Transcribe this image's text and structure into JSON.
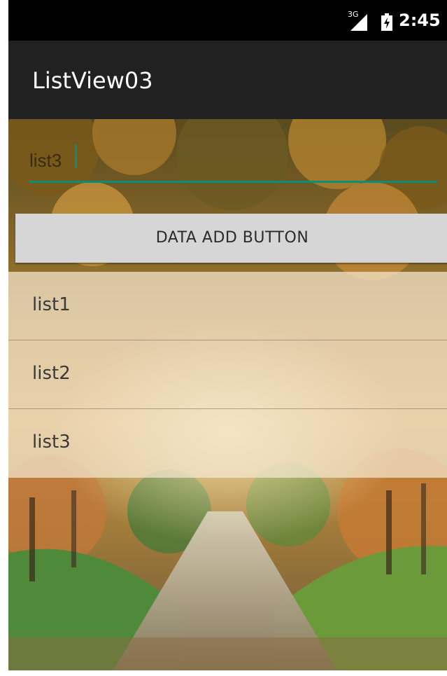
{
  "status_bar": {
    "network": "3G",
    "time": "2:45"
  },
  "action_bar": {
    "title": "ListView03"
  },
  "input": {
    "value": "list3"
  },
  "add_button": {
    "label": "DATA ADD BUTTON"
  },
  "list": {
    "items": [
      {
        "label": "list1"
      },
      {
        "label": "list2"
      },
      {
        "label": "list3"
      }
    ]
  },
  "colors": {
    "status_bar": "#000000",
    "action_bar": "#212121",
    "accent": "#0e8c7a",
    "button": "#d6d6d6"
  },
  "icons": [
    "signal-icon",
    "battery-icon"
  ]
}
